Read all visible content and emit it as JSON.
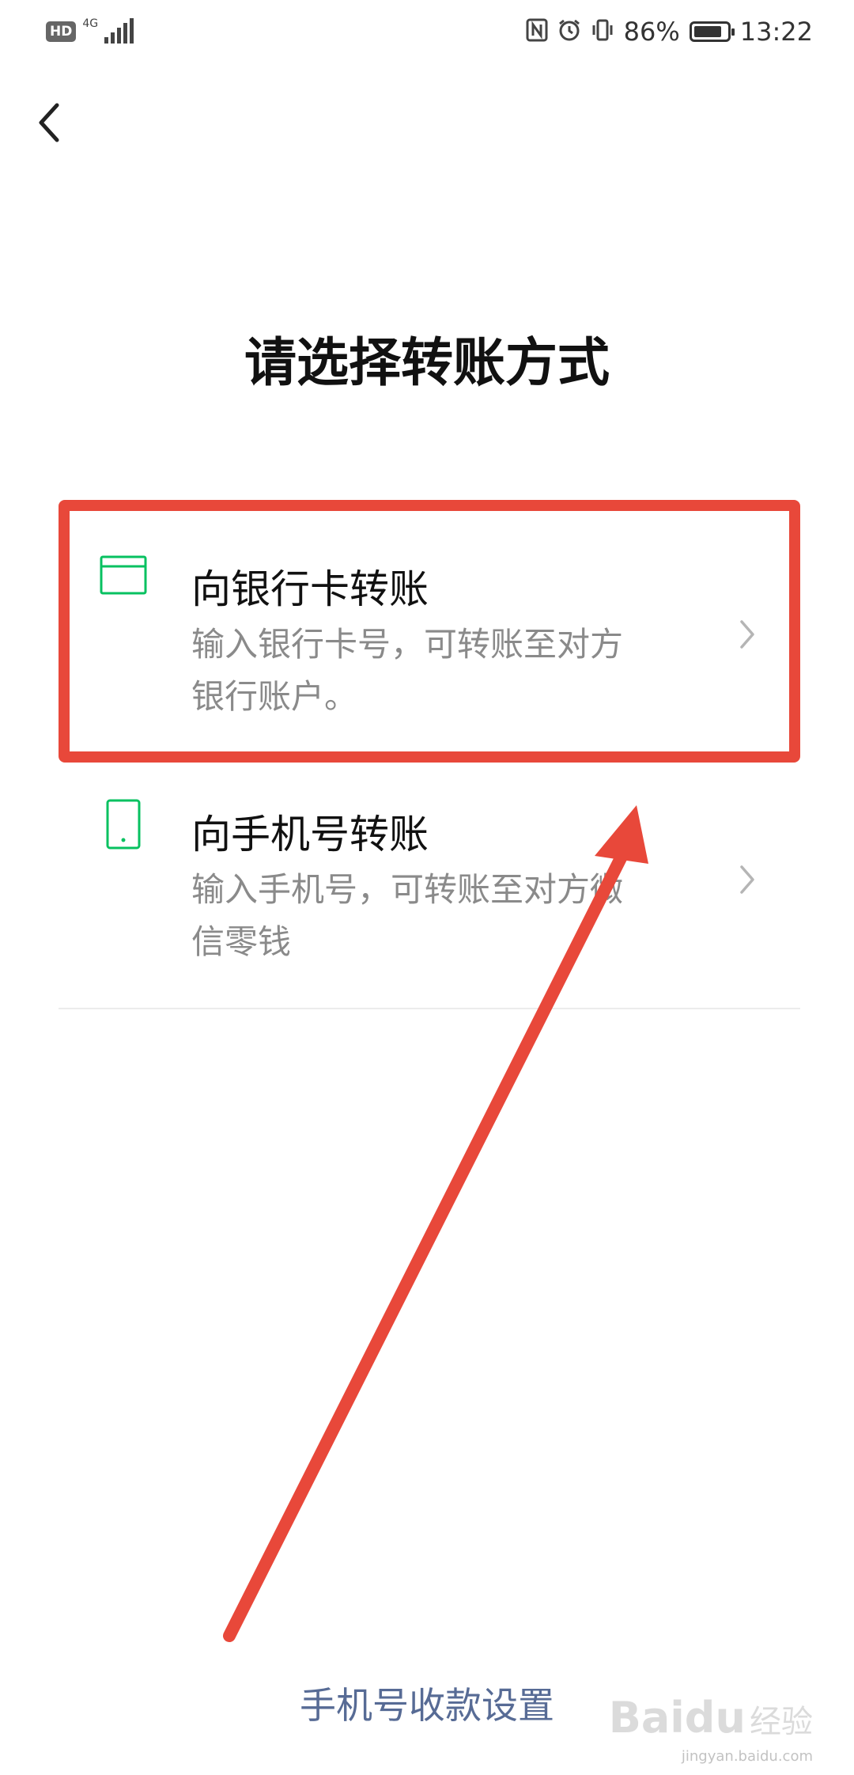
{
  "status_bar": {
    "hd_label": "HD",
    "network_label": "4G",
    "battery_text": "86%",
    "battery_level": 0.86,
    "time": "13:22",
    "icons": [
      "nfc-icon",
      "alarm-icon",
      "vibrate-icon"
    ]
  },
  "header": {
    "back_icon": "chevron-left-icon"
  },
  "page": {
    "title": "请选择转账方式"
  },
  "options": [
    {
      "icon": "bank-card-icon",
      "title": "向银行卡转账",
      "desc_line1": "输入银行卡号，可转账至对方",
      "desc_line2": "银行账户。",
      "highlighted": true
    },
    {
      "icon": "phone-icon",
      "title": "向手机号转账",
      "desc_line1": "输入手机号，可转账至对方微",
      "desc_line2": "信零钱",
      "highlighted": false
    }
  ],
  "footer": {
    "link": "手机号收款设置"
  },
  "watermark": {
    "brand": "Baidu",
    "sub": "经验",
    "url": "jingyan.baidu.com"
  },
  "colors": {
    "accent_green": "#07c160",
    "annotation_red": "#e8483a",
    "link_blue": "#576b95"
  }
}
